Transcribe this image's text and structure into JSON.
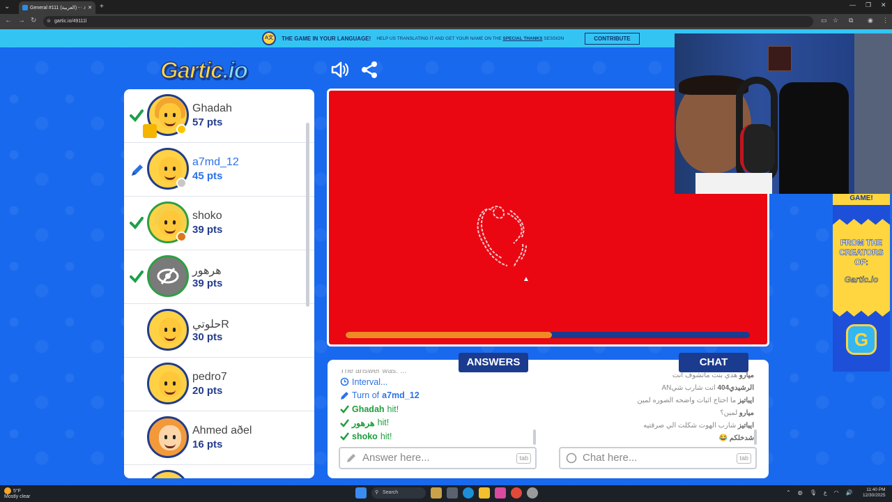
{
  "browser": {
    "tab_title": "General #111 (العربية) - Gartic",
    "url": "gartic.io/49111l"
  },
  "banner": {
    "headline": "THE GAME IN YOUR LANGUAGE!",
    "sub_a": "HELP US TRANSLATING IT AND GET YOUR NAME ON THE ",
    "sub_link": "SPECIAL THANKS",
    "sub_b": " SESSION",
    "button": "CONTRIBUTE"
  },
  "logo": {
    "text_main": "Gartic",
    "text_suffix": ".io"
  },
  "players": [
    {
      "name": "Ghadah",
      "pts": "57 pts",
      "status": "hit",
      "avatar": "girl"
    },
    {
      "name": "a7md_12",
      "pts": "45 pts",
      "status": "drawing",
      "avatar": "boy"
    },
    {
      "name": "shoko",
      "pts": "39 pts",
      "status": "hit",
      "avatar": "girl2"
    },
    {
      "name": "هرهور",
      "pts": "39 pts",
      "status": "hit",
      "avatar": "gray"
    },
    {
      "name": "حلوتيR",
      "pts": "30 pts",
      "status": "none",
      "avatar": "boy"
    },
    {
      "name": "pedro7",
      "pts": "20 pts",
      "status": "none",
      "avatar": "boy"
    },
    {
      "name": "Ahmed aðel",
      "pts": "16 pts",
      "status": "none",
      "avatar": "boy2"
    }
  ],
  "timer": {
    "progress": 0.51
  },
  "tabs": {
    "answers": "ANSWERS",
    "chat": "CHAT"
  },
  "answers_log": [
    {
      "text": "The answer was: ...",
      "kind": "gray"
    },
    {
      "text": "Interval...",
      "kind": "info"
    },
    {
      "prefix": "Turn of ",
      "who": "a7md_12",
      "kind": "turn"
    },
    {
      "who": "Ghadah",
      "suffix": " hit!",
      "kind": "hit"
    },
    {
      "who": "هرهور",
      "suffix": " hit!",
      "kind": "hit"
    },
    {
      "who": "shoko",
      "suffix": " hit!",
      "kind": "hit"
    }
  ],
  "chat_log": [
    {
      "who": "ميارو",
      "msg": " هدي بنت ماتشوف انت"
    },
    {
      "who": "الرشيدي404",
      "msg": " انت شارب شيAN"
    },
    {
      "who": "ايباتيز",
      "msg": " ما احتاج اثبات واضحه الصوره لمين"
    },
    {
      "who": "ميارو",
      "msg": " لمين؟"
    },
    {
      "who": "ايباتيز",
      "msg": " شارب الهوت شكلت الي صرقتيه"
    },
    {
      "who": "شدخلكم",
      "msg": " 😂"
    }
  ],
  "answer_input": {
    "placeholder": "Answer here...",
    "key": "tab"
  },
  "chat_input": {
    "placeholder": "Chat here...",
    "key": "tab"
  },
  "ad": {
    "top": "GAME!",
    "line1": "FROM THE CREATORS OF:",
    "line2": "Gartic.io",
    "badge": "G"
  },
  "taskbar": {
    "temp": "5°F",
    "weather": "Mostly clear",
    "search": "Search",
    "time": "11:40 PM",
    "date": "12/30/2025"
  }
}
